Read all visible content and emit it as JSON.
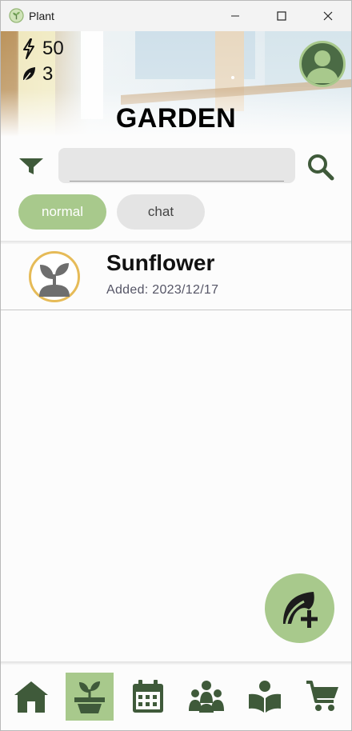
{
  "window": {
    "title": "Plant"
  },
  "header": {
    "energy": "50",
    "leaves": "3",
    "title": "GARDEN"
  },
  "search": {
    "value": "",
    "placeholder": ""
  },
  "chips": [
    {
      "label": "normal",
      "active": true
    },
    {
      "label": "chat",
      "active": false
    }
  ],
  "plants": [
    {
      "name": "Sunflower",
      "added": "Added: 2023/12/17"
    }
  ],
  "bottom_nav": [
    {
      "icon": "home-icon",
      "active": false
    },
    {
      "icon": "potted-plant-icon",
      "active": true
    },
    {
      "icon": "calendar-icon",
      "active": false
    },
    {
      "icon": "community-icon",
      "active": false
    },
    {
      "icon": "reading-icon",
      "active": false
    },
    {
      "icon": "cart-icon",
      "active": false
    }
  ],
  "colors": {
    "accent": "#a8c98c",
    "icon_dark": "#3f5a3a",
    "plant_ring": "#e6bb58"
  }
}
